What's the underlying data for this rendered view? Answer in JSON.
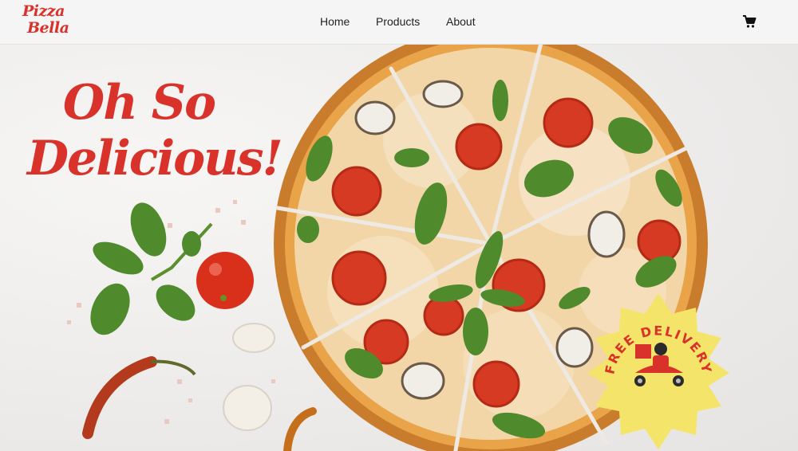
{
  "brand": {
    "line1": "Pizza",
    "line2": "Bella",
    "color": "#d8322b"
  },
  "nav": {
    "items": [
      {
        "label": "Home"
      },
      {
        "label": "Products"
      },
      {
        "label": "About"
      }
    ]
  },
  "cart": {
    "icon": "cart-icon"
  },
  "hero": {
    "title_line1": "Oh So",
    "title_line2": "Delicious!",
    "badge": {
      "text": "FREE DELIVERY",
      "icon": "delivery-scooter-icon",
      "color": "#f5e46a"
    }
  }
}
